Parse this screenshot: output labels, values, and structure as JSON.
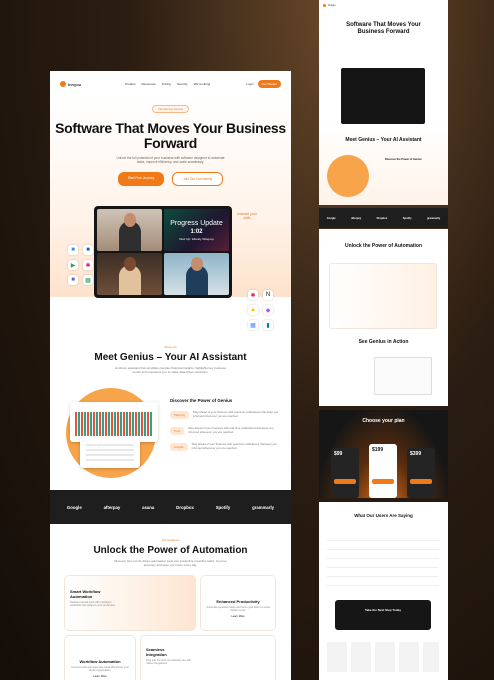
{
  "nav": {
    "brand": "Innyou",
    "links": [
      "Product",
      "Resources",
      "Pricing",
      "Security",
      "We're Hiring"
    ],
    "login": "Login",
    "cta": "Get Started"
  },
  "hero": {
    "badge": "Introducing Genius",
    "title": "Software That Moves Your Business Forward",
    "subtitle": "Unlock the full potential of your business with software designed to automate tasks, improve efficiency, and scale seamlessly.",
    "primary": "Start Free Journey",
    "secondary": "Join Our Community",
    "annotation": "unleash your skills"
  },
  "video": {
    "title": "Progress Update",
    "time": "1:02",
    "subtitle": "Next Up: Weekly Wrap-up"
  },
  "genius": {
    "eyebrow": "About Us",
    "title": "Meet Genius – Your AI Assistant",
    "subtitle": "AI-driven assistant that simplifies complex financial insights, highlights key business trends and empowers you to make data-driven decisions.",
    "discover": "Discover the Power of Genius",
    "features": [
      {
        "tag": "Planning",
        "text": "Stay ahead of your finances with real-time notifications that keep you informed whenever you are reached."
      },
      {
        "tag": "Trust",
        "text": "Stay ahead of your finances with real-time notifications that keep you informed whenever you are reached."
      },
      {
        "tag": "Insights",
        "text": "Stay ahead of your finances with real-time notifications that keep you informed whenever you are reached."
      }
    ]
  },
  "logos": [
    "Google",
    "afterpay",
    "asana",
    "Dropbox",
    "Spotify",
    "grammarly"
  ],
  "automation": {
    "eyebrow": "Our Features",
    "title": "Unlock the Power of Automation",
    "subtitle": "Discover how our AI-driven automation tools can streamline repetitive tasks, improve accuracy and save you hours every day.",
    "cards": [
      {
        "title": "Smart Workflow Automation",
        "text": "Reduce manual work with intelligent workflows that adapt to your processes."
      },
      {
        "title": "Enhanced Productivity",
        "text": "Automate repetitive tasks and focus your team on what matters most.",
        "link": "Learn More"
      },
      {
        "title": "Workflow Automation",
        "text": "Connect tools and automate hand-offs across your whole organisation.",
        "link": "Learn More"
      },
      {
        "title": "Seamless Integration",
        "text": "Plug into the tools you already use with native integrations."
      }
    ]
  },
  "side": {
    "hero_title": "Software That Moves Your Business Forward",
    "genius_title": "Meet Genius – Your AI Assistant",
    "discover": "Discover the Power of Genius",
    "auto_title": "Unlock the Power of Automation",
    "action_title": "See Genius in Action",
    "plan_title": "Choose your plan",
    "prices": [
      "$99",
      "$199",
      "$399"
    ],
    "users_title": "What Our Users Are Saying",
    "next_step": "Take the Next Step Today"
  }
}
